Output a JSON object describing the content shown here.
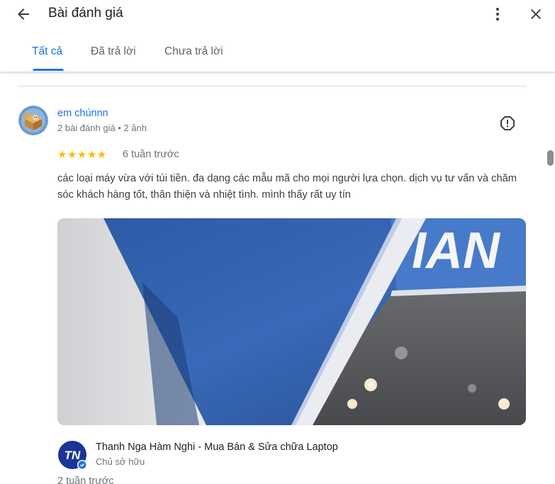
{
  "header": {
    "title": "Bài đánh giá",
    "back_icon": "arrow-left-icon",
    "more_icon": "more-vert-icon",
    "close_icon": "close-icon"
  },
  "tabs": [
    {
      "label": "Tất cả",
      "active": true
    },
    {
      "label": "Đã trả lời",
      "active": false
    },
    {
      "label": "Chưa trả lời",
      "active": false
    }
  ],
  "review": {
    "author": "em chúnnn",
    "meta": "2 bài đánh giá • 2 ảnh",
    "stars": "★★★★★",
    "rating": 5,
    "time": "6 tuần trước",
    "text": "các loại máy vừa với túi tiền. đa dạng các mẫu mã cho mọi người lựa chọn. dịch vụ tư vấn và chăm sóc khách hàng tốt, thân thiện và nhiệt tình. mình thấy rất uy tín",
    "photo_sign_text": "IAN"
  },
  "owner_reply": {
    "name": "Thanh Nga Hàm Nghi - Mua Bán & Sửa chữa Laptop",
    "role": "Chủ sở hữu",
    "time": "2 tuần trước",
    "logo_text": "TN"
  },
  "colors": {
    "accent": "#1a73e8",
    "star": "#fbbc04",
    "secondary_text": "#70757a"
  }
}
